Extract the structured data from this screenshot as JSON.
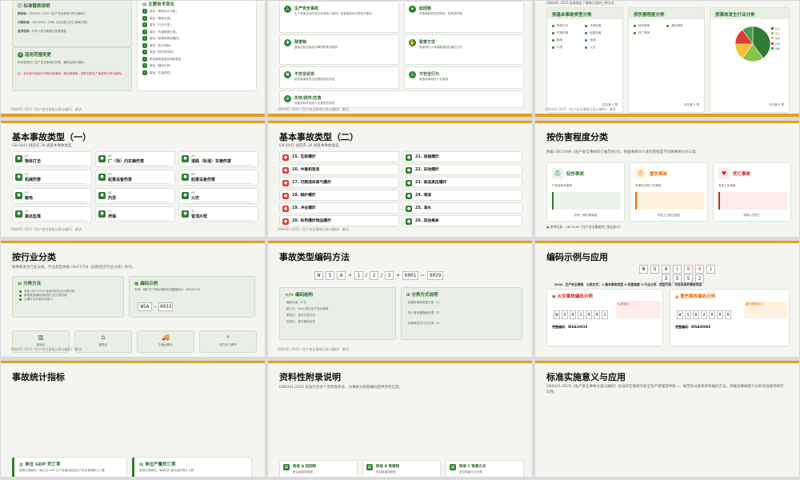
{
  "footer": "GB6441-2025《生产安全事故分类与编码》 解读",
  "s0": {
    "left_title": "标准替换说明",
    "items": [
      {
        "k": "新标准：",
        "v": "GB6441-2025《生产安全事故分类与编码》"
      },
      {
        "k": "代替标准：",
        "v": "GB/T6441-1986《企业职工伤亡事故分类》"
      },
      {
        "k": "发布机构：",
        "v": "中华人民共和国应急管理部"
      }
    ],
    "scope_title": "适用范围变更",
    "scope_text": "本标准规定了生产安全事故的分类、编码及统计指标。",
    "scope_red": "注：本标准不适用于环境污染事故、核设施事故、国防科研生产事故的分类与编码。",
    "right_title": "主要技术变化",
    "changes": [
      "增加「事故统计对象」",
      "增加「事故分类」",
      "增加「行业分类」",
      "增加「伤害程度分类」",
      "增加「按事故类型编码」",
      "增加「统计指标」",
      "增加「资料性附录」",
      "修改事故类型名称和数量",
      "增加「编码示例」",
      "增加「实施指导」"
    ]
  },
  "s1": {
    "cards": [
      {
        "icon": "生产安全事故",
        "title": "生产安全事故",
        "text": "生产经营活动中发生的造成人身伤亡或者直接经济损失的事件"
      },
      {
        "icon": "起因物",
        "title": "起因物",
        "text": "导致事故发生的物体、物质或环境"
      },
      {
        "icon": "致害物",
        "title": "致害物",
        "text": "直接引起伤害及中毒的物体或物质"
      },
      {
        "icon": "致害方式",
        "title": "致害方式",
        "text": "致害物与人体接触造成伤害的方式"
      },
      {
        "icon": "不安全状态",
        "title": "不安全状态",
        "text": "能导致事故发生的物的危险状态"
      },
      {
        "icon": "不安全行为",
        "title": "不安全行为",
        "text": "能造成事故的人为错误"
      },
      {
        "icon": "失效/损伤/危害",
        "title": "失效/损伤/危害",
        "text": "设备材料失效或人员损伤的表现"
      }
    ]
  },
  "s2": {
    "header_text": "GB6441-2025 标准规定了事故分类的三种方式",
    "cards": [
      {
        "title": "按基本事故类型分类",
        "items": [
          "物体打击",
          "车辆伤害",
          "机械伤害",
          "起重伤害",
          "触电",
          "淹溺",
          "灼烫",
          "火灾"
        ],
        "foot": "详见第 4 章"
      },
      {
        "title": "按伤害程度分类",
        "items": [
          "轻伤事故",
          "重伤事故",
          "死亡事故"
        ],
        "foot": "详见第 5 章"
      },
      {
        "title": "按事故发生行业分类",
        "items": [
          "矿山",
          "化工",
          "建筑",
          "交通",
          "其他"
        ],
        "foot": "详见第 6 章"
      }
    ],
    "pie": [
      {
        "name": "矿山",
        "value": 40,
        "color": "#2e7d32"
      },
      {
        "name": "化工",
        "value": 20,
        "color": "#8bc34a"
      },
      {
        "name": "建筑",
        "value": 15,
        "color": "#fbc02d"
      },
      {
        "name": "交通",
        "value": 15,
        "color": "#e53935"
      },
      {
        "name": "其他",
        "value": 10,
        "color": "#43a047"
      }
    ]
  },
  "s3": {
    "title": "基本事故类型（一）",
    "subtitle": "GB 6441 规定的 26 类基本事故类型",
    "items": [
      {
        "n": "01",
        "name": "物体打击"
      },
      {
        "n": "02",
        "name": "厂（场）内车辆伤害"
      },
      {
        "n": "03",
        "name": "道路（轨道）车辆伤害"
      },
      {
        "n": "04",
        "name": "机械伤害"
      },
      {
        "n": "05",
        "name": "起重设备伤害"
      },
      {
        "n": "06",
        "name": "起重设备伤害"
      },
      {
        "n": "07",
        "name": "触电"
      },
      {
        "n": "08",
        "name": "灼烫"
      },
      {
        "n": "09",
        "name": "火灾"
      },
      {
        "n": "10",
        "name": "高处坠落"
      },
      {
        "n": "11",
        "name": "坍塌"
      },
      {
        "n": "12",
        "name": "冒顶片帮"
      },
      {
        "n": "13",
        "name": "透水"
      },
      {
        "n": "14",
        "name": "爆破"
      }
    ]
  },
  "s4": {
    "title": "基本事故类型（二）",
    "subtitle": "GB 6441 规定的 26 类基本事故类型",
    "items": [
      {
        "n": "15.",
        "name": "瓦斯爆炸"
      },
      {
        "n": "21.",
        "name": "容器爆炸"
      },
      {
        "n": "16.",
        "name": "中毒和窒息"
      },
      {
        "n": "22.",
        "name": "其他爆炸"
      },
      {
        "n": "17.",
        "name": "可燃液体蒸气爆炸"
      },
      {
        "n": "23.",
        "name": "高温高压爆炸"
      },
      {
        "n": "18.",
        "name": "锅炉爆炸"
      },
      {
        "n": "24.",
        "name": "淹溺"
      },
      {
        "n": "19.",
        "name": "冲击爆炸"
      },
      {
        "n": "25.",
        "name": "溺水"
      },
      {
        "n": "20.",
        "name": "民用爆炸物品爆炸"
      },
      {
        "n": "26.",
        "name": "其他事故"
      }
    ]
  },
  "s5": {
    "title": "按伤害程度分类",
    "intro": "依据 GB15499《生产安全事故伤亡报告统计》，根据事故对人体伤害程度不同将事故分为三类：",
    "cards": [
      {
        "name": "轻伤事故",
        "tag": "只有轻伤的事故",
        "foot": "仅有一种伤害等级"
      },
      {
        "name": "重伤事故",
        "tag": "有重伤无死亡的事故",
        "foot": "失能工日超过规定"
      },
      {
        "name": "死亡事故",
        "tag": "有死亡的事故",
        "foot": "导致人员死亡"
      }
    ],
    "note": "参考标准：GB15499《生产安全事故伤亡报告统计》"
  },
  "s6": {
    "title": "按行业分类",
    "intro": "按事故发生行业分类，行业类型依据 GB/T4754《国民经济行业分类》执行。",
    "left_title": "分类方法",
    "left_items": [
      "采用 GB/T4754 标准中的行业分类代码",
      "事故类型编码后附加行业分类代码",
      "主要行业分类代码如下"
    ],
    "right_title": "编码示例",
    "right_text": "示例：煤矿井下透水事故的完整编码为：WSA0033",
    "code": [
      "WSA",
      "-",
      "0033"
    ],
    "tiles": [
      "制造业",
      "建筑业",
      "交通运输业",
      "电力热力燃气"
    ]
  },
  "s7": {
    "title": "事故类型编码方法",
    "code": [
      "W",
      "S",
      "A",
      "+",
      "1",
      "/",
      "2",
      "/",
      "3",
      "+",
      "0001",
      "~",
      "0029"
    ],
    "left_title": "编码结构",
    "left_items": [
      "编码长度：8 位",
      "前三位：WSA 表示生产安全事故",
      "第四位：表示分类方式",
      "后四位：表示事故序号"
    ],
    "right_title": "分类方式说明",
    "right_items": [
      "按基本事故类型分类（1）",
      "按人身伤害程度分类（2）",
      "按事故发生行业分类（3）"
    ]
  },
  "s8": {
    "title": "编码示例与应用",
    "code": [
      "W",
      "S",
      "A",
      "1",
      "0",
      "0",
      "1"
    ],
    "code2": [
      "3",
      "5",
      "5",
      "2"
    ],
    "legend": [
      "WSA：生产安全事故",
      "分类方式：1-基本事故类型 2-伤害程度 3-行业分类",
      "类型代码：对应具体的事故类型"
    ],
    "ex1_title": "火灾事故编码示例",
    "ex1_code": [
      "W",
      "S",
      "A",
      "1",
      "0",
      "0",
      "1"
    ],
    "ex1_note": "火灾定义：",
    "ex1_text": "完整编码：WSA10010",
    "ex2_title": "重伤事故编码示例",
    "ex2_code": [
      "W",
      "S",
      "A",
      "2",
      "0",
      "0",
      "0"
    ],
    "ex2_note": "重伤事故定义：",
    "ex2_text": "完整编码：WSA20002"
  },
  "s9": {
    "title": "事故统计指标",
    "cards": [
      {
        "title": "单位 GDP 死亡率",
        "text": "某统计周期内，每亿元 GDP 生产总值对应的生产安全事故死亡人数"
      },
      {
        "title": "单位产量死亡率",
        "text": "某统计周期内，每单位产量对应的死亡人数"
      }
    ]
  },
  "s10": {
    "title": "资料性附录说明",
    "intro": "GB6441-2025 标准包含多个资料性附录，为事故分类和编码提供参考信息。",
    "cards": [
      {
        "title": "附录 A  起因物",
        "text": "常见起因物类型"
      },
      {
        "title": "附录 B  致害物",
        "text": "常见致害物类型"
      },
      {
        "title": "附录 C  致害方式",
        "text": "常见致害方式分类"
      }
    ]
  },
  "s11": {
    "title": "标准实施意义与应用",
    "intro": "GB6441-2025《生产安全事故分类与编码》标准的实施将为安全生产管理提供统一、规范的分类体系和编码方法，将推动事故统计分析的准确性和可比性。"
  }
}
